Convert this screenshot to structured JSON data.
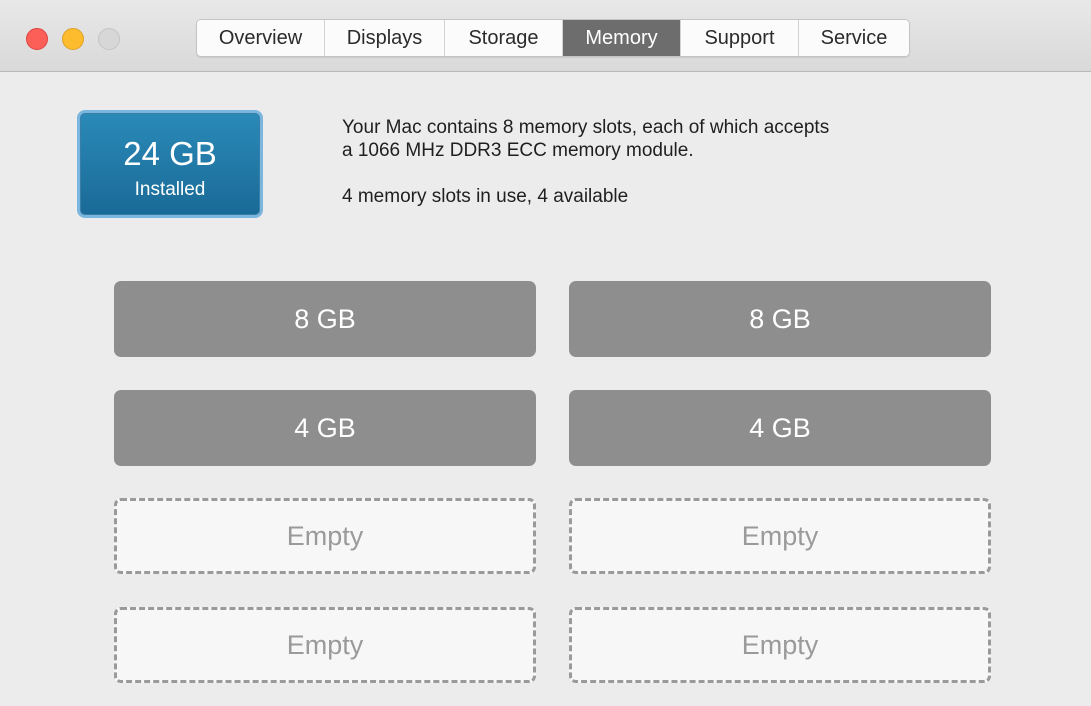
{
  "window": {
    "traffic_lights": [
      "close",
      "minimize",
      "zoom"
    ],
    "colors": {
      "close": "#fc5f57",
      "minimize": "#fdbc2e",
      "zoom": "#d7d7d7",
      "active_tab": "#6d6d6d",
      "badge": "#1f78a8",
      "filled_slot": "#8e8e8e"
    }
  },
  "tabs": [
    {
      "label": "Overview"
    },
    {
      "label": "Displays"
    },
    {
      "label": "Storage"
    },
    {
      "label": "Memory",
      "active": true
    },
    {
      "label": "Support"
    },
    {
      "label": "Service"
    }
  ],
  "summary": {
    "installed_size": "24 GB",
    "installed_label": "Installed",
    "description_line1": "Your Mac contains 8 memory slots, each of which accepts",
    "description_line2": "a 1066 MHz DDR3 ECC memory module.",
    "usage": "4 memory slots in use, 4 available"
  },
  "slots": [
    {
      "label": "8 GB",
      "state": "filled"
    },
    {
      "label": "8 GB",
      "state": "filled"
    },
    {
      "label": "4 GB",
      "state": "filled"
    },
    {
      "label": "4 GB",
      "state": "filled"
    },
    {
      "label": "Empty",
      "state": "empty"
    },
    {
      "label": "Empty",
      "state": "empty"
    },
    {
      "label": "Empty",
      "state": "empty"
    },
    {
      "label": "Empty",
      "state": "empty"
    }
  ]
}
